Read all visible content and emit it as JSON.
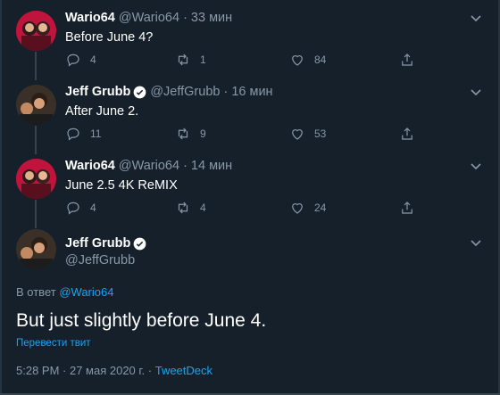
{
  "tweets": [
    {
      "name": "Wario64",
      "meta": "@Wario64 · 33 мин",
      "text": "Before June 4?",
      "verified": false,
      "replies": "4",
      "retweets": "1",
      "likes": "84"
    },
    {
      "name": "Jeff Grubb",
      "meta": "@JeffGrubb · 16 мин",
      "text": "After June 2.",
      "verified": true,
      "replies": "11",
      "retweets": "9",
      "likes": "53"
    },
    {
      "name": "Wario64",
      "meta": "@Wario64 · 14 мин",
      "text": "June 2.5 4K ReMIX",
      "verified": false,
      "replies": "4",
      "retweets": "4",
      "likes": "24"
    }
  ],
  "main_tweet": {
    "name": "Jeff Grubb",
    "handle": "@JeffGrubb",
    "reply_prefix": "В ответ",
    "reply_to": "@Wario64",
    "text": "But just slightly before June 4.",
    "translate": "Перевести твит",
    "timestamp": "5:28 PM · 27 мая 2020 г. · ",
    "source": "TweetDeck"
  },
  "colors": {
    "background": "#15202b",
    "accent": "#1da1f2",
    "muted": "#8899a6"
  },
  "icons": [
    "caret-down-icon",
    "reply-icon",
    "retweet-icon",
    "like-icon",
    "share-icon",
    "verified-badge-icon"
  ]
}
